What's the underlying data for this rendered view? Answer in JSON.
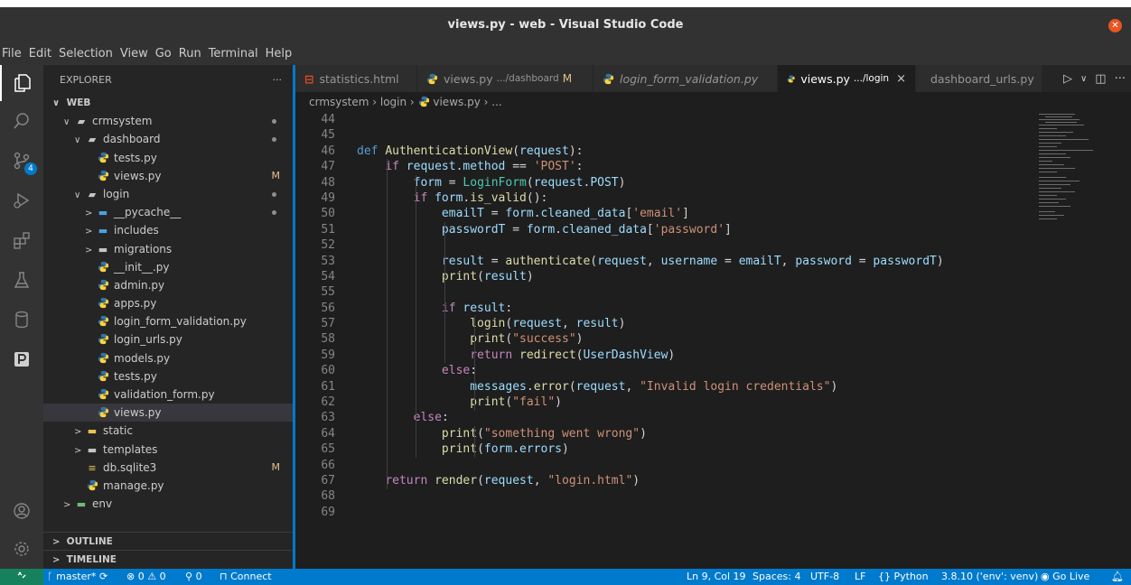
{
  "window": {
    "title": "views.py - web - Visual Studio Code"
  },
  "menu": [
    "File",
    "Edit",
    "Selection",
    "View",
    "Go",
    "Run",
    "Terminal",
    "Help"
  ],
  "activity": {
    "scm_badge": "4"
  },
  "explorer": {
    "header": "EXPLORER",
    "more": "···",
    "root": "WEB",
    "items": [
      {
        "label": "crmsystem",
        "type": "folder-open",
        "deco": "dot"
      },
      {
        "label": "dashboard",
        "type": "folder-open",
        "deco": "dot"
      },
      {
        "label": "tests.py",
        "type": "py",
        "deco": ""
      },
      {
        "label": "views.py",
        "type": "py",
        "deco": "M"
      },
      {
        "label": "login",
        "type": "folder-open",
        "deco": "dot"
      },
      {
        "label": "__pycache__",
        "type": "folder",
        "deco": "dot"
      },
      {
        "label": "includes",
        "type": "folder",
        "deco": ""
      },
      {
        "label": "migrations",
        "type": "folder",
        "deco": ""
      },
      {
        "label": "__init__.py",
        "type": "py",
        "deco": ""
      },
      {
        "label": "admin.py",
        "type": "py",
        "deco": ""
      },
      {
        "label": "apps.py",
        "type": "py",
        "deco": ""
      },
      {
        "label": "login_form_validation.py",
        "type": "py",
        "deco": ""
      },
      {
        "label": "login_urls.py",
        "type": "py",
        "deco": ""
      },
      {
        "label": "models.py",
        "type": "py",
        "deco": ""
      },
      {
        "label": "tests.py",
        "type": "py",
        "deco": ""
      },
      {
        "label": "validation_form.py",
        "type": "py",
        "deco": ""
      },
      {
        "label": "views.py",
        "type": "py",
        "deco": ""
      },
      {
        "label": "static",
        "type": "folder",
        "deco": ""
      },
      {
        "label": "templates",
        "type": "folder",
        "deco": ""
      },
      {
        "label": "db.sqlite3",
        "type": "db",
        "deco": "M"
      },
      {
        "label": "manage.py",
        "type": "py",
        "deco": ""
      },
      {
        "label": "env",
        "type": "folder",
        "deco": ""
      }
    ],
    "outline": "OUTLINE",
    "timeline": "TIMELINE"
  },
  "tabs": [
    {
      "label": "statistics.html",
      "sub": "",
      "flag": "",
      "icon": "html"
    },
    {
      "label": "views.py",
      "sub": ".../dashboard",
      "flag": "M",
      "icon": "py"
    },
    {
      "label": "login_form_validation.py",
      "sub": "",
      "flag": "",
      "icon": "py"
    },
    {
      "label": "views.py",
      "sub": ".../login",
      "flag": "×",
      "icon": "py"
    },
    {
      "label": "dashboard_urls.py",
      "sub": "",
      "flag": "",
      "icon": "py"
    }
  ],
  "breadcrumb": {
    "p1": "crmsystem",
    "p2": "login",
    "p3": "views.py",
    "p4": "..."
  },
  "code": [
    {
      "n": "44",
      "t": []
    },
    {
      "n": "45",
      "t": []
    },
    {
      "n": "46",
      "t": [
        [
          "kwb",
          "def "
        ],
        [
          "fn",
          "AuthenticationView"
        ],
        [
          "op",
          "("
        ],
        [
          "var",
          "request"
        ],
        [
          "op",
          "):"
        ]
      ]
    },
    {
      "n": "47",
      "t": [
        [
          "op",
          "    "
        ],
        [
          "kw",
          "if "
        ],
        [
          "var",
          "request"
        ],
        [
          "op",
          "."
        ],
        [
          "var",
          "method"
        ],
        [
          "op",
          " == "
        ],
        [
          "str",
          "'POST'"
        ],
        [
          "op",
          ":"
        ]
      ]
    },
    {
      "n": "48",
      "t": [
        [
          "op",
          "        "
        ],
        [
          "var",
          "form"
        ],
        [
          "op",
          " = "
        ],
        [
          "cls",
          "LoginForm"
        ],
        [
          "op",
          "("
        ],
        [
          "var",
          "request"
        ],
        [
          "op",
          "."
        ],
        [
          "var",
          "POST"
        ],
        [
          "op",
          ")"
        ]
      ]
    },
    {
      "n": "49",
      "t": [
        [
          "op",
          "        "
        ],
        [
          "kw",
          "if "
        ],
        [
          "var",
          "form"
        ],
        [
          "op",
          "."
        ],
        [
          "fn",
          "is_valid"
        ],
        [
          "op",
          "():"
        ]
      ]
    },
    {
      "n": "50",
      "t": [
        [
          "op",
          "            "
        ],
        [
          "var",
          "emailT"
        ],
        [
          "op",
          " = "
        ],
        [
          "var",
          "form"
        ],
        [
          "op",
          "."
        ],
        [
          "var",
          "cleaned_data"
        ],
        [
          "op",
          "["
        ],
        [
          "str",
          "'email'"
        ],
        [
          "op",
          "]"
        ]
      ]
    },
    {
      "n": "51",
      "t": [
        [
          "op",
          "            "
        ],
        [
          "var",
          "passwordT"
        ],
        [
          "op",
          " = "
        ],
        [
          "var",
          "form"
        ],
        [
          "op",
          "."
        ],
        [
          "var",
          "cleaned_data"
        ],
        [
          "op",
          "["
        ],
        [
          "str",
          "'password'"
        ],
        [
          "op",
          "]"
        ]
      ]
    },
    {
      "n": "52",
      "t": []
    },
    {
      "n": "53",
      "t": [
        [
          "op",
          "            "
        ],
        [
          "var",
          "result"
        ],
        [
          "op",
          " = "
        ],
        [
          "fn",
          "authenticate"
        ],
        [
          "op",
          "("
        ],
        [
          "var",
          "request"
        ],
        [
          "op",
          ", "
        ],
        [
          "var",
          "username"
        ],
        [
          "op",
          " = "
        ],
        [
          "var",
          "emailT"
        ],
        [
          "op",
          ", "
        ],
        [
          "var",
          "password"
        ],
        [
          "op",
          " = "
        ],
        [
          "var",
          "passwordT"
        ],
        [
          "op",
          ")"
        ]
      ]
    },
    {
      "n": "54",
      "t": [
        [
          "op",
          "            "
        ],
        [
          "fn",
          "print"
        ],
        [
          "op",
          "("
        ],
        [
          "var",
          "result"
        ],
        [
          "op",
          ")"
        ]
      ]
    },
    {
      "n": "55",
      "t": []
    },
    {
      "n": "56",
      "t": [
        [
          "op",
          "            "
        ],
        [
          "kw",
          "if "
        ],
        [
          "var",
          "result"
        ],
        [
          "op",
          ":"
        ]
      ]
    },
    {
      "n": "57",
      "t": [
        [
          "op",
          "                "
        ],
        [
          "fn",
          "login"
        ],
        [
          "op",
          "("
        ],
        [
          "var",
          "request"
        ],
        [
          "op",
          ", "
        ],
        [
          "var",
          "result"
        ],
        [
          "op",
          ")"
        ]
      ]
    },
    {
      "n": "58",
      "t": [
        [
          "op",
          "                "
        ],
        [
          "fn",
          "print"
        ],
        [
          "op",
          "("
        ],
        [
          "str",
          "\"success\""
        ],
        [
          "op",
          ")"
        ]
      ]
    },
    {
      "n": "59",
      "t": [
        [
          "op",
          "                "
        ],
        [
          "kw",
          "return "
        ],
        [
          "fn",
          "redirect"
        ],
        [
          "op",
          "("
        ],
        [
          "var",
          "UserDashView"
        ],
        [
          "op",
          ")"
        ]
      ]
    },
    {
      "n": "60",
      "t": [
        [
          "op",
          "            "
        ],
        [
          "kw",
          "else"
        ],
        [
          "op",
          ":"
        ]
      ]
    },
    {
      "n": "61",
      "t": [
        [
          "op",
          "                "
        ],
        [
          "var",
          "messages"
        ],
        [
          "op",
          "."
        ],
        [
          "fn",
          "error"
        ],
        [
          "op",
          "("
        ],
        [
          "var",
          "request"
        ],
        [
          "op",
          ", "
        ],
        [
          "str",
          "\"Invalid login credentials\""
        ],
        [
          "op",
          ")"
        ]
      ]
    },
    {
      "n": "62",
      "t": [
        [
          "op",
          "                "
        ],
        [
          "fn",
          "print"
        ],
        [
          "op",
          "("
        ],
        [
          "str",
          "\"fail\""
        ],
        [
          "op",
          ")"
        ]
      ]
    },
    {
      "n": "63",
      "t": [
        [
          "op",
          "        "
        ],
        [
          "kw",
          "else"
        ],
        [
          "op",
          ":"
        ]
      ]
    },
    {
      "n": "64",
      "t": [
        [
          "op",
          "            "
        ],
        [
          "fn",
          "print"
        ],
        [
          "op",
          "("
        ],
        [
          "str",
          "\"something went wrong\""
        ],
        [
          "op",
          ")"
        ]
      ]
    },
    {
      "n": "65",
      "t": [
        [
          "op",
          "            "
        ],
        [
          "fn",
          "print"
        ],
        [
          "op",
          "("
        ],
        [
          "var",
          "form"
        ],
        [
          "op",
          "."
        ],
        [
          "var",
          "errors"
        ],
        [
          "op",
          ")"
        ]
      ]
    },
    {
      "n": "66",
      "t": []
    },
    {
      "n": "67",
      "t": [
        [
          "op",
          "    "
        ],
        [
          "kw",
          "return "
        ],
        [
          "fn",
          "render"
        ],
        [
          "op",
          "("
        ],
        [
          "var",
          "request"
        ],
        [
          "op",
          ", "
        ],
        [
          "str",
          "\"login.html\""
        ],
        [
          "op",
          ")"
        ]
      ]
    },
    {
      "n": "68",
      "t": []
    },
    {
      "n": "69",
      "t": []
    }
  ],
  "status": {
    "branch": "master*",
    "errors": "0",
    "warnings": "0",
    "ports": "0",
    "connect": "Connect",
    "position": "Ln 9, Col 19",
    "spaces": "Spaces: 4",
    "encoding": "UTF-8",
    "eol": "LF",
    "language": "Python",
    "interpreter": "3.8.10 ('env': venv)",
    "golive": "Go Live"
  },
  "colors": {
    "accent": "#007acc",
    "remote": "#16825d",
    "modified": "#e2c08d",
    "python_blue": "#3572a5",
    "python_yellow": "#ffd43b"
  }
}
